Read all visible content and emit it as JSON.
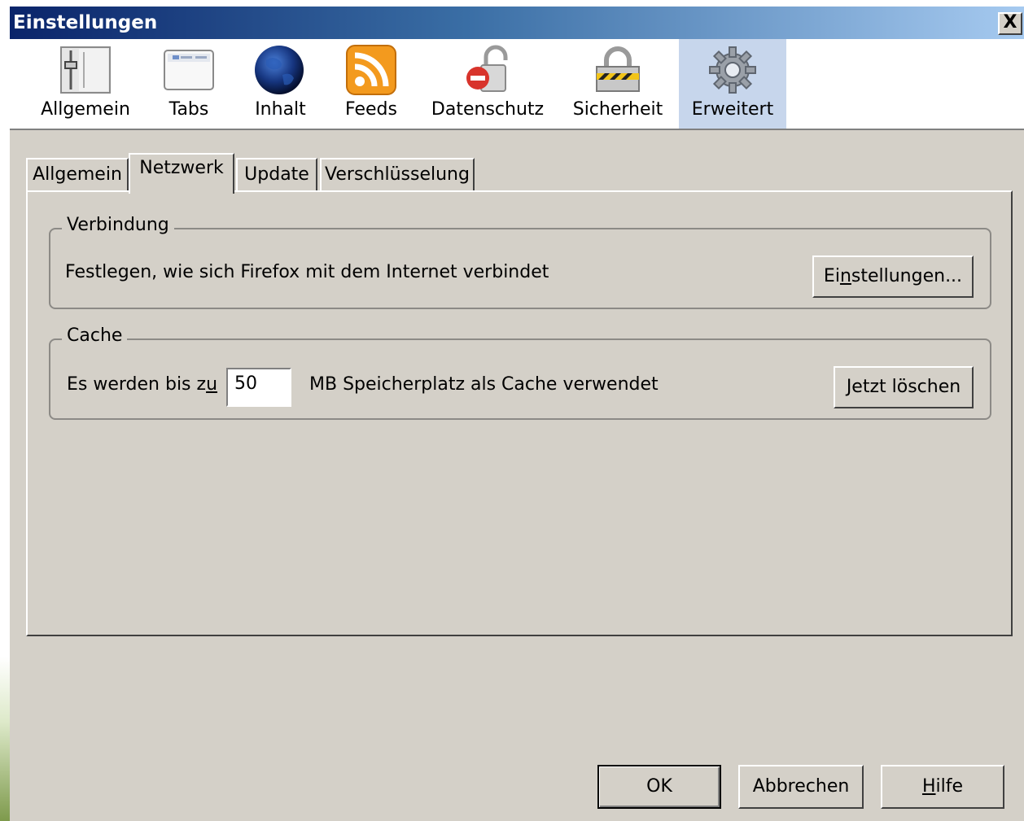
{
  "window": {
    "title": "Einstellungen",
    "close_glyph": "X"
  },
  "toolbar": {
    "items": [
      {
        "label": "Allgemein",
        "icon": "general-switches-icon"
      },
      {
        "label": "Tabs",
        "icon": "tabs-window-icon"
      },
      {
        "label": "Inhalt",
        "icon": "globe-icon"
      },
      {
        "label": "Feeds",
        "icon": "rss-feed-icon"
      },
      {
        "label": "Datenschutz",
        "icon": "privacy-lock-remove-icon"
      },
      {
        "label": "Sicherheit",
        "icon": "security-padlock-icon"
      },
      {
        "label": "Erweitert",
        "icon": "gear-icon"
      }
    ],
    "selected": "Erweitert"
  },
  "tabs": {
    "items": [
      "Allgemein",
      "Netzwerk",
      "Update",
      "Verschlüsselung"
    ],
    "active": "Netzwerk"
  },
  "connection": {
    "legend": "Verbindung",
    "description": "Festlegen, wie sich Firefox mit dem Internet verbindet",
    "button_prefix": "Ei",
    "button_mnemonic": "n",
    "button_suffix": "stellungen..."
  },
  "cache": {
    "legend": "Cache",
    "label_prefix": "Es werden bis z",
    "label_mnemonic": "u",
    "size_value": "50",
    "label_suffix": "MB Speicherplatz als Cache verwendet",
    "clear_button": "Jetzt löschen"
  },
  "footer": {
    "ok": "OK",
    "cancel": "Abbrechen",
    "help_mnemonic": "H",
    "help_suffix": "ilfe"
  },
  "colors": {
    "titlebar_start": "#0a246a",
    "titlebar_end": "#a6caf0",
    "dialog_face": "#d4d0c8",
    "selected_toolbar": "#c7d6ec"
  }
}
